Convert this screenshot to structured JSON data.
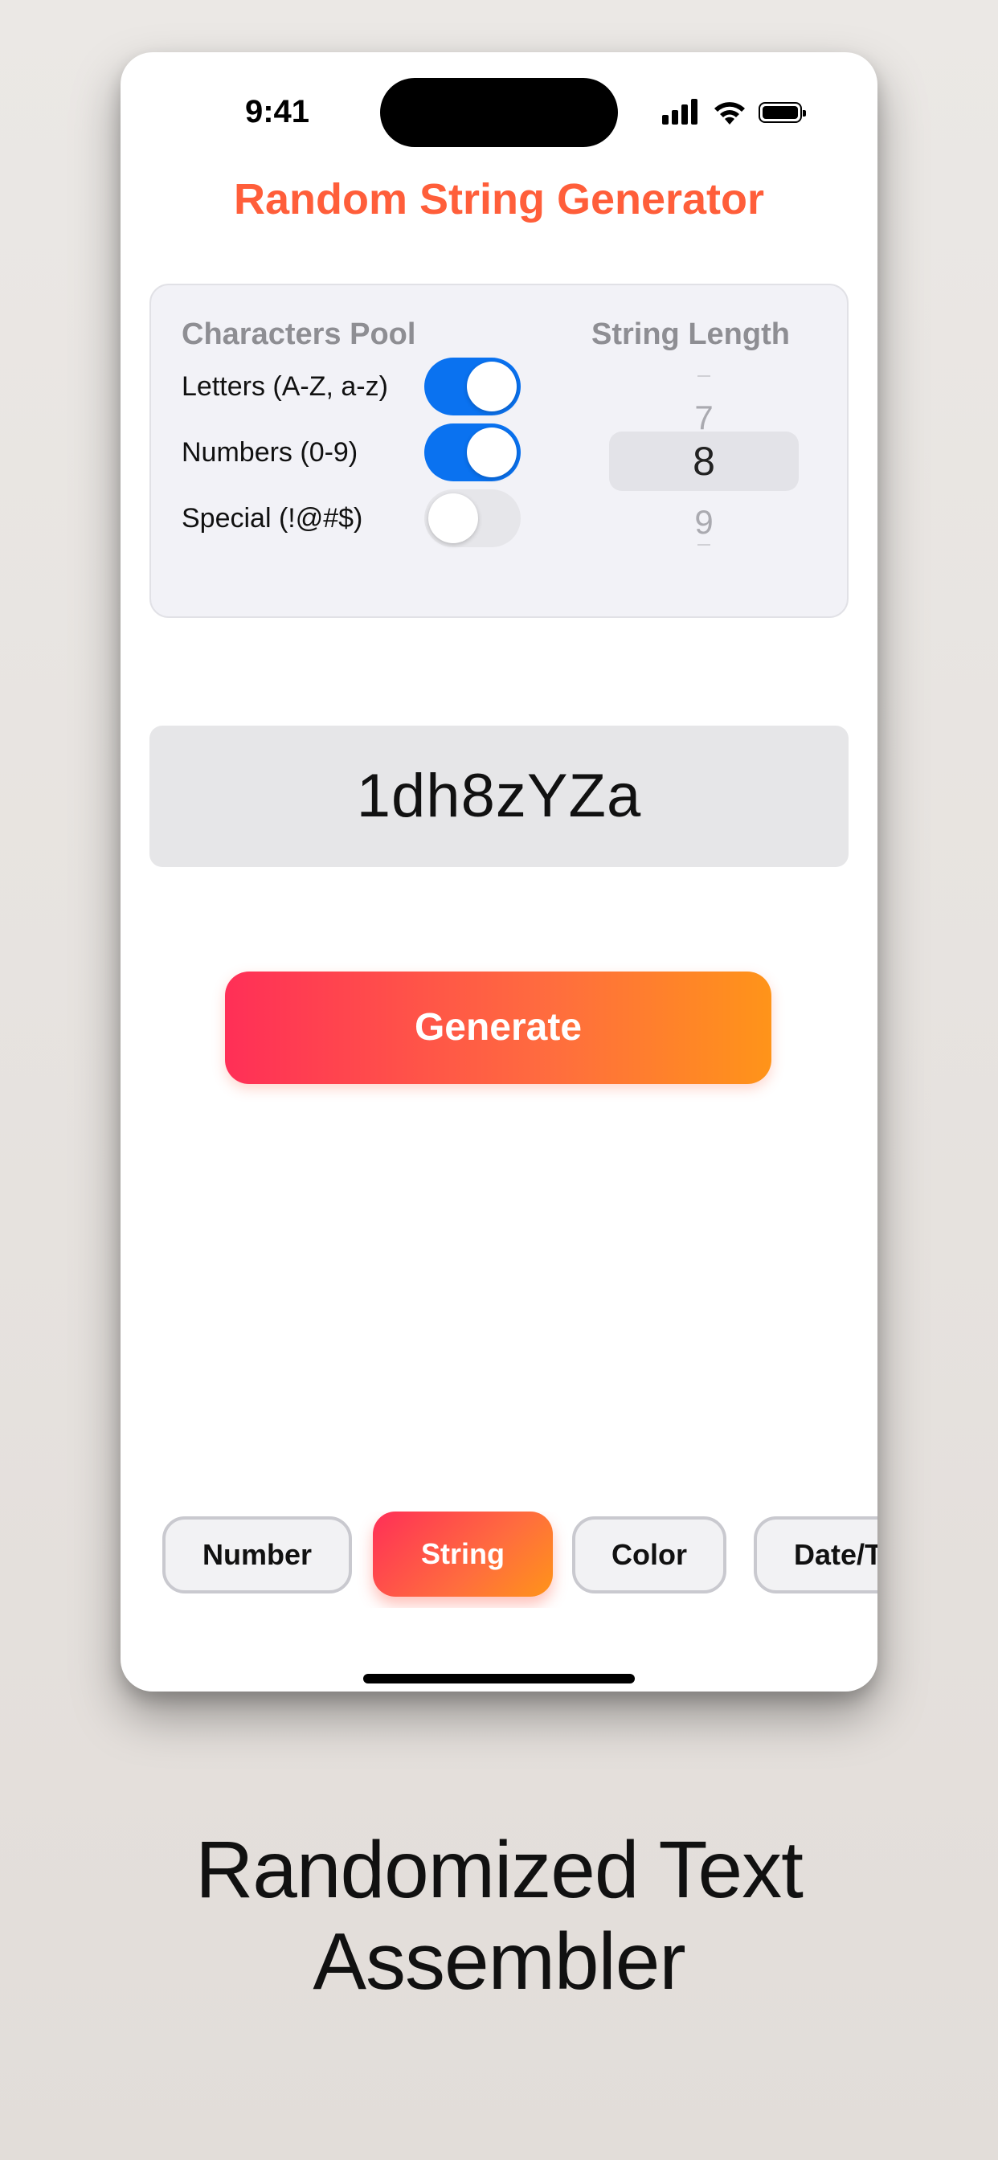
{
  "status_bar": {
    "time": "9:41",
    "icons": [
      "cellular-signal-icon",
      "wifi-icon",
      "battery-icon"
    ]
  },
  "app": {
    "title": "Random String Generator",
    "title_color": "#ff5e3a"
  },
  "settings": {
    "pool_heading": "Characters Pool",
    "length_heading": "String Length",
    "toggles": [
      {
        "label": "Letters (A-Z, a-z)",
        "on": true
      },
      {
        "label": "Numbers (0-9)",
        "on": true
      },
      {
        "label": "Special (!@#$)",
        "on": false
      }
    ],
    "length_picker": {
      "previous": "7",
      "selected": "8",
      "next": "9"
    }
  },
  "result": {
    "value": "1dh8zYZa"
  },
  "generate_button": {
    "label": "Generate"
  },
  "tabs": [
    {
      "label": "Number",
      "active": false
    },
    {
      "label": "String",
      "active": true
    },
    {
      "label": "Color",
      "active": false
    },
    {
      "label": "Date/T",
      "active": false
    }
  ],
  "caption": {
    "line1": "Randomized Text",
    "line2": "Assembler"
  },
  "colors": {
    "accent_start": "#ff2f57",
    "accent_end": "#ff9419",
    "toggle_on": "#0a72f0",
    "toggle_off": "#e6e6ea"
  }
}
